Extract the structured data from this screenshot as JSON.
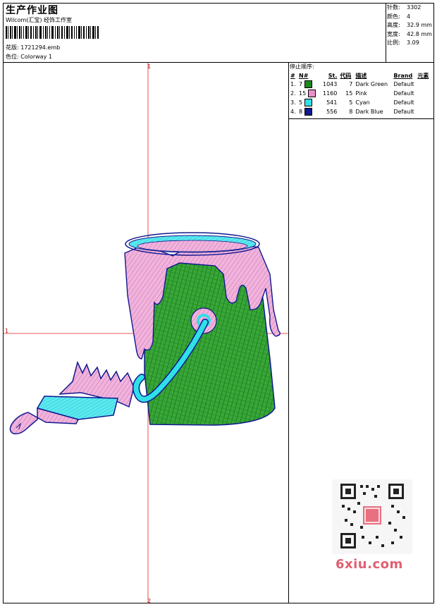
{
  "header": {
    "title": "生产作业图",
    "company": "Wilcom(汇宝) 经饰工作室",
    "design_label": "花版:",
    "design_value": "1721294.emb",
    "colorway_label": "色位:",
    "colorway_value": "Colorway 1"
  },
  "stats": {
    "stitches_label": "针数:",
    "stitches_value": "3302",
    "colors_label": "颜色:",
    "colors_value": "4",
    "height_label": "高度:",
    "height_value": "32.9 mm",
    "width_label": "宽度:",
    "width_value": "42.8 mm",
    "ratio_label": "比例:",
    "ratio_value": "3.09"
  },
  "stop_sequence": {
    "title": "停止顺序:",
    "headers": [
      "#",
      "N#",
      "St.",
      "代码",
      "描述",
      "Brand",
      "元素"
    ],
    "rows": [
      {
        "idx": "1.",
        "n": "7",
        "color": "#1a8a1a",
        "st": "1043",
        "code": "7",
        "desc": "Dark Green",
        "brand": "Default"
      },
      {
        "idx": "2.",
        "n": "15",
        "color": "#e890c8",
        "st": "1160",
        "code": "15",
        "desc": "Pink",
        "brand": "Default"
      },
      {
        "idx": "3.",
        "n": "5",
        "color": "#30e0e8",
        "st": "541",
        "code": "5",
        "desc": "Cyan",
        "brand": "Default"
      },
      {
        "idx": "4.",
        "n": "8",
        "color": "#101890",
        "st": "556",
        "code": "8",
        "desc": "Dark Blue",
        "brand": "Default"
      }
    ]
  },
  "axes": {
    "top": "1",
    "left": "1",
    "bottom": "2"
  },
  "watermark": {
    "site": "6xiu.com"
  },
  "colors": {
    "green": "#1a8a1a",
    "pink": "#e890c8",
    "cyan": "#30e0e8",
    "blue": "#101890",
    "axis": "#e02020"
  },
  "icons": [
    "barcode-icon",
    "qr-code-icon",
    "paint-bucket-embroidery",
    "paint-brush-embroidery"
  ]
}
